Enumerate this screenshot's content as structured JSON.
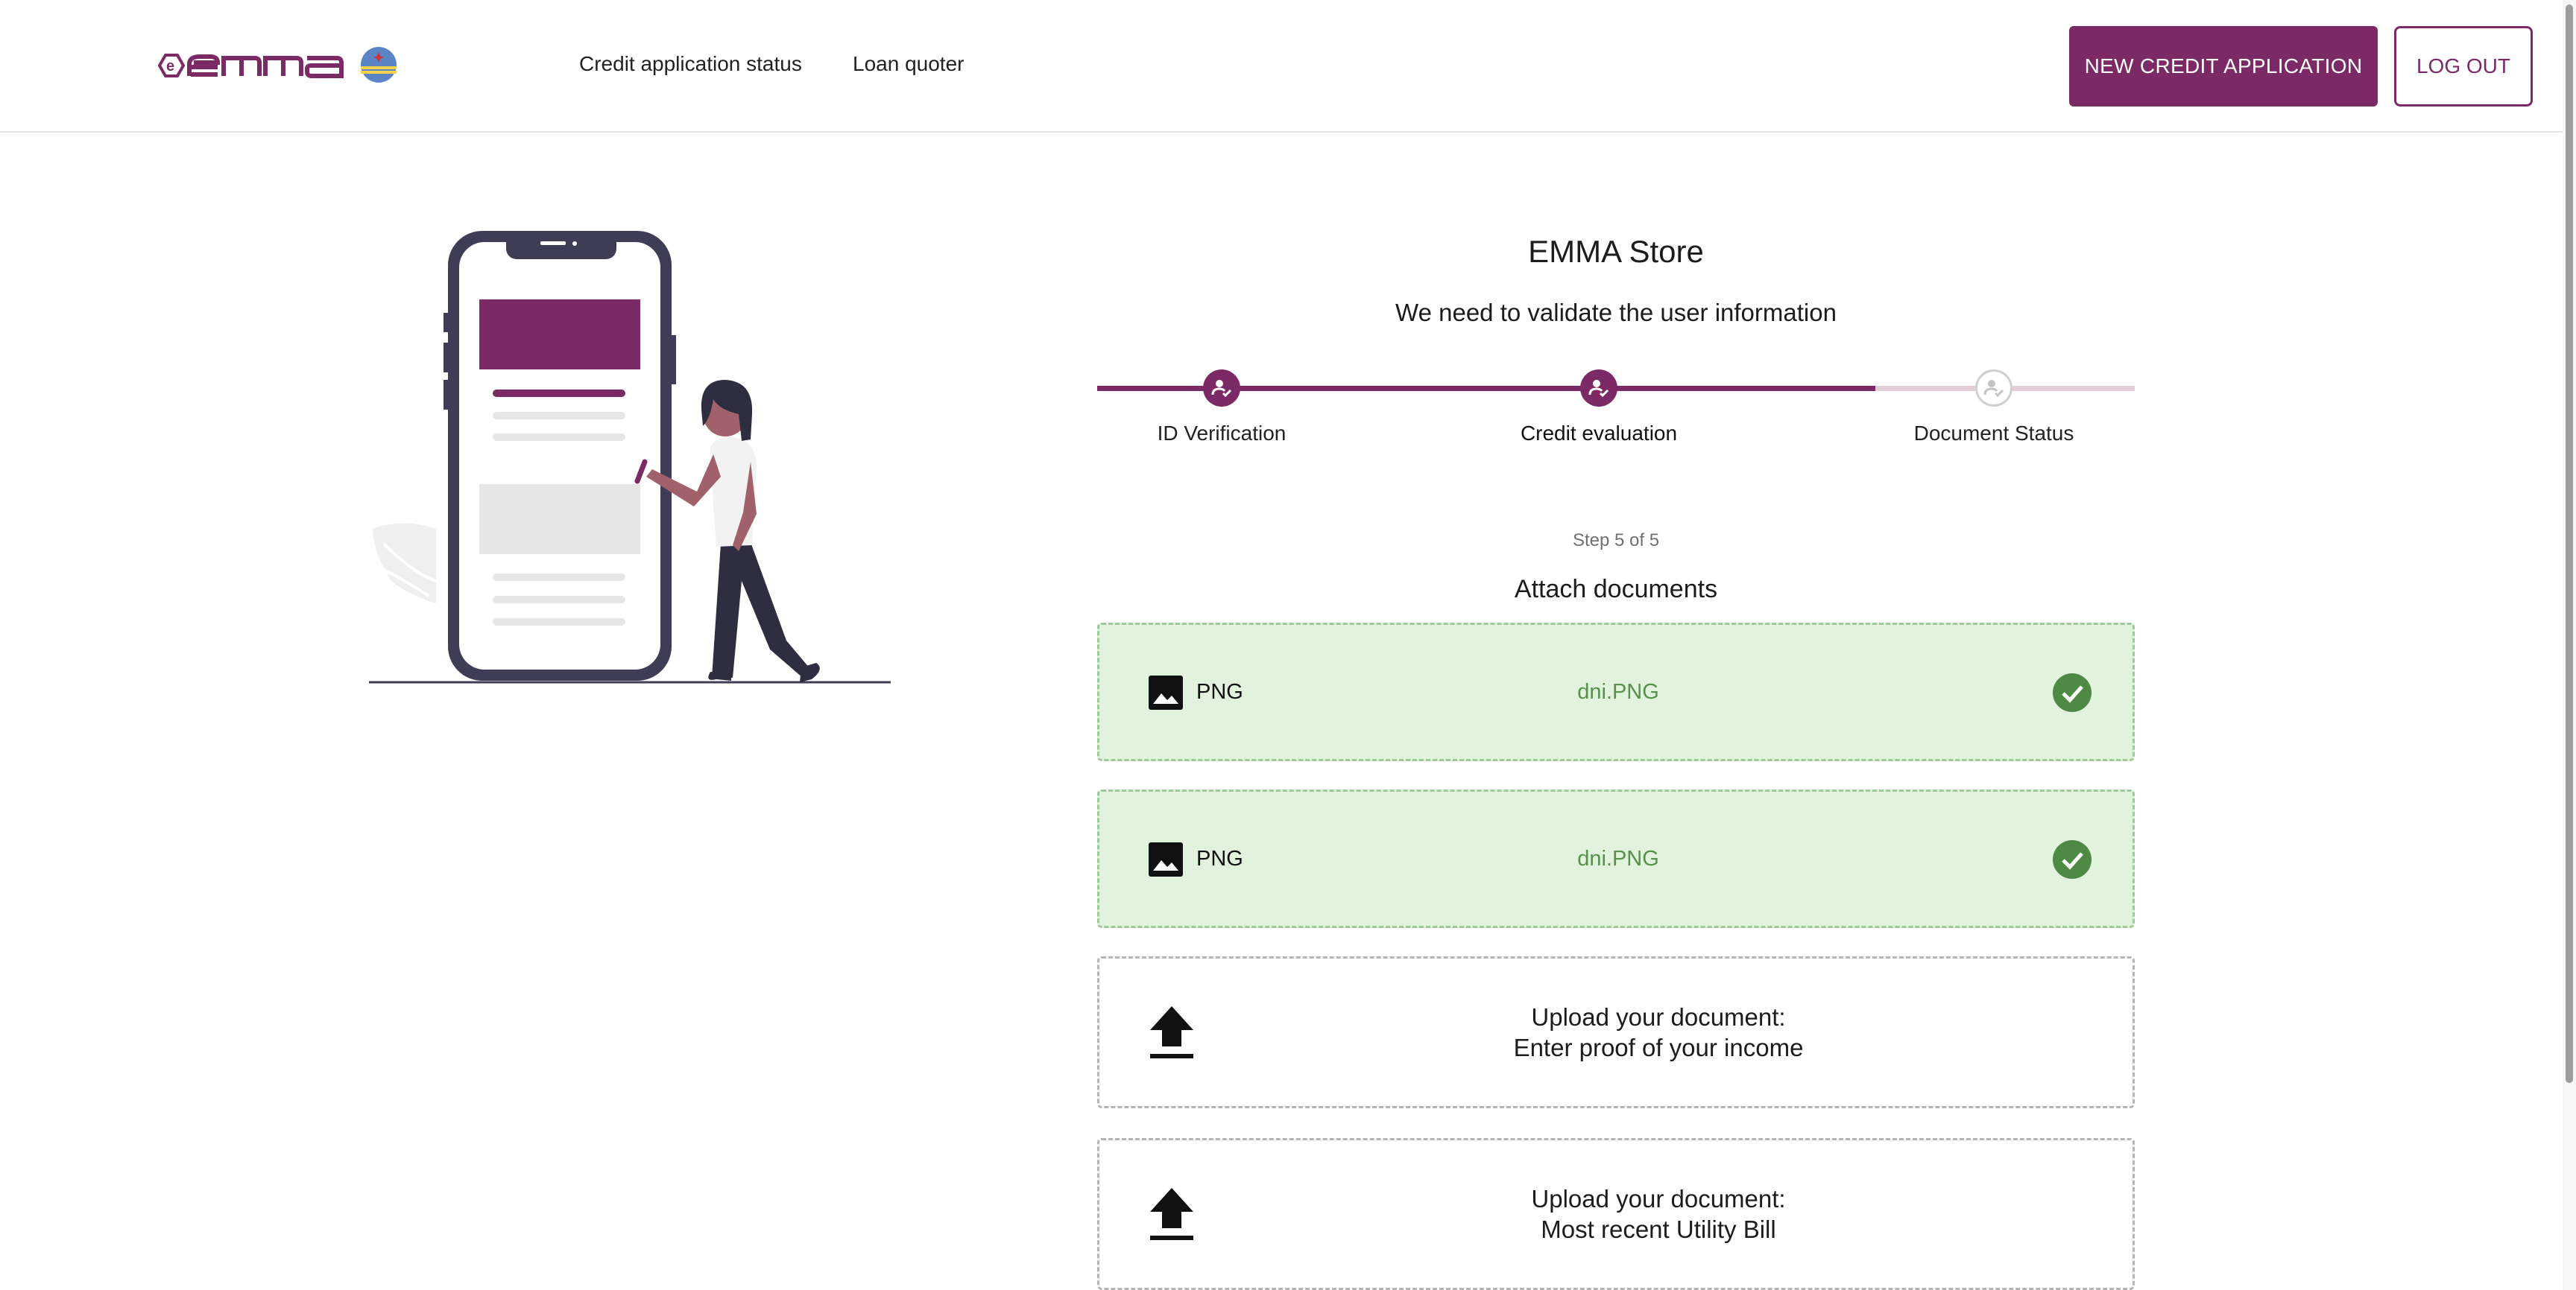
{
  "brand": {
    "logo_text": "emma",
    "accent_color": "#7b2a66"
  },
  "nav": {
    "links": [
      "Credit application status",
      "Loan quoter"
    ],
    "new_application_label": "NEW CREDIT APPLICATION",
    "logout_label": "LOG OUT"
  },
  "store": {
    "title": "EMMA Store",
    "subtitle": "We need to validate the user information"
  },
  "stepper": {
    "steps": [
      {
        "label": "ID Verification",
        "state": "done"
      },
      {
        "label": "Credit evaluation",
        "state": "done"
      },
      {
        "label": "Document Status",
        "state": "todo"
      }
    ]
  },
  "progress": {
    "step_text": "Step 5 of 5",
    "section_title": "Attach documents"
  },
  "documents": [
    {
      "type": "PNG",
      "file_name": "dni.PNG",
      "status": "uploaded"
    },
    {
      "type": "PNG",
      "file_name": "dni.PNG",
      "status": "uploaded"
    },
    {
      "line1": "Upload your document:",
      "line2": "Enter proof of your income",
      "status": "pending"
    },
    {
      "line1": "Upload your document:",
      "line2": "Most recent Utility Bill",
      "status": "pending"
    }
  ],
  "colors": {
    "uploaded_bg": "#e1f3dc",
    "uploaded_text": "#5a8f4f",
    "check": "#4f8a45"
  }
}
